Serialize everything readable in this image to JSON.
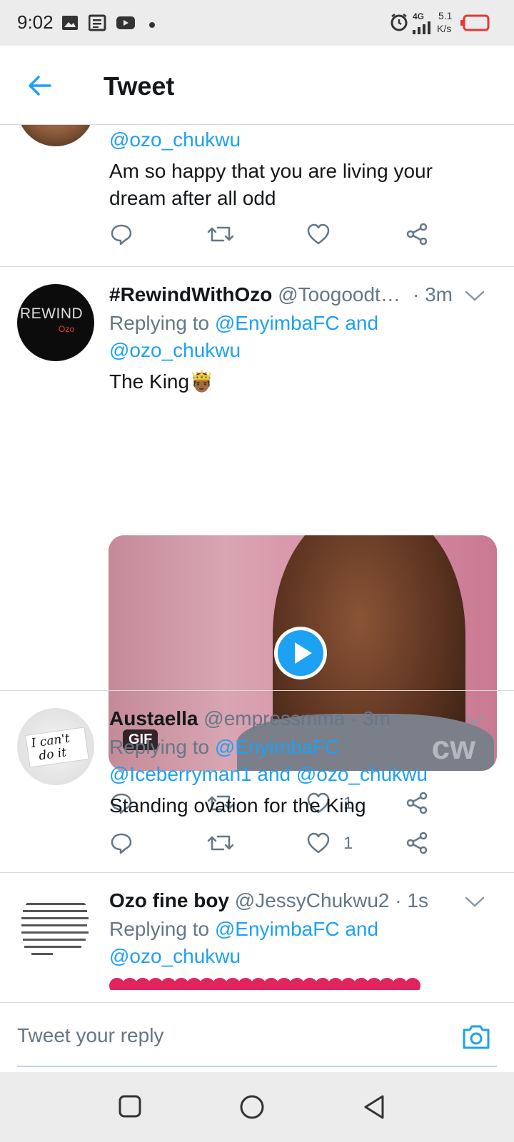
{
  "status_bar": {
    "time": "9:02",
    "network_type": "4G",
    "speed_value": "5.1",
    "speed_unit": "K/s",
    "icons": [
      "image-icon",
      "news-icon",
      "youtube-icon",
      "dot-icon",
      "alarm-icon",
      "signal-icon",
      "battery-icon"
    ]
  },
  "header": {
    "title": "Tweet"
  },
  "tweets": [
    {
      "reply_to": "@ozo_chukwu",
      "text_line1": "Am so happy that you are living your",
      "text_line2": "dream after all odd"
    },
    {
      "name": "#RewindWithOzo",
      "handle": "@Toogoodt…",
      "time": "· 3m",
      "reply_prefix": "Replying to",
      "reply_line1": "@EnyimbaFC and",
      "reply_line2": "@ozo_chukwu",
      "text": "The King",
      "emoji": "🤴🏾",
      "avatar_text": "REWIND",
      "avatar_sub": "Ozo",
      "media_badge": "GIF",
      "media_watermark": "cw",
      "likes": "1"
    },
    {
      "name": "Austaella",
      "handle": "@empressmma",
      "time": "· 3m",
      "reply_prefix": "Replying to",
      "reply_line1": "@EnyimbaFC",
      "reply_line2": "@Iceberryman1 and @ozo_chukwu",
      "text": "Standing ovation for the King",
      "avatar_text_1": "I can't",
      "avatar_text_2": "do it",
      "likes": "1"
    },
    {
      "name": "Ozo fine boy",
      "handle": "@JessyChukwu2",
      "time": "· 1s",
      "reply_prefix": "Replying to",
      "reply_line1": "@EnyimbaFC and",
      "reply_line2": "@ozo_chukwu"
    }
  ],
  "reply_bar": {
    "placeholder": "Tweet your reply"
  },
  "colors": {
    "accent": "#1da1f2",
    "muted": "#657786",
    "text": "#14171a",
    "battery": "#e53935",
    "heart": "#e0245e"
  }
}
